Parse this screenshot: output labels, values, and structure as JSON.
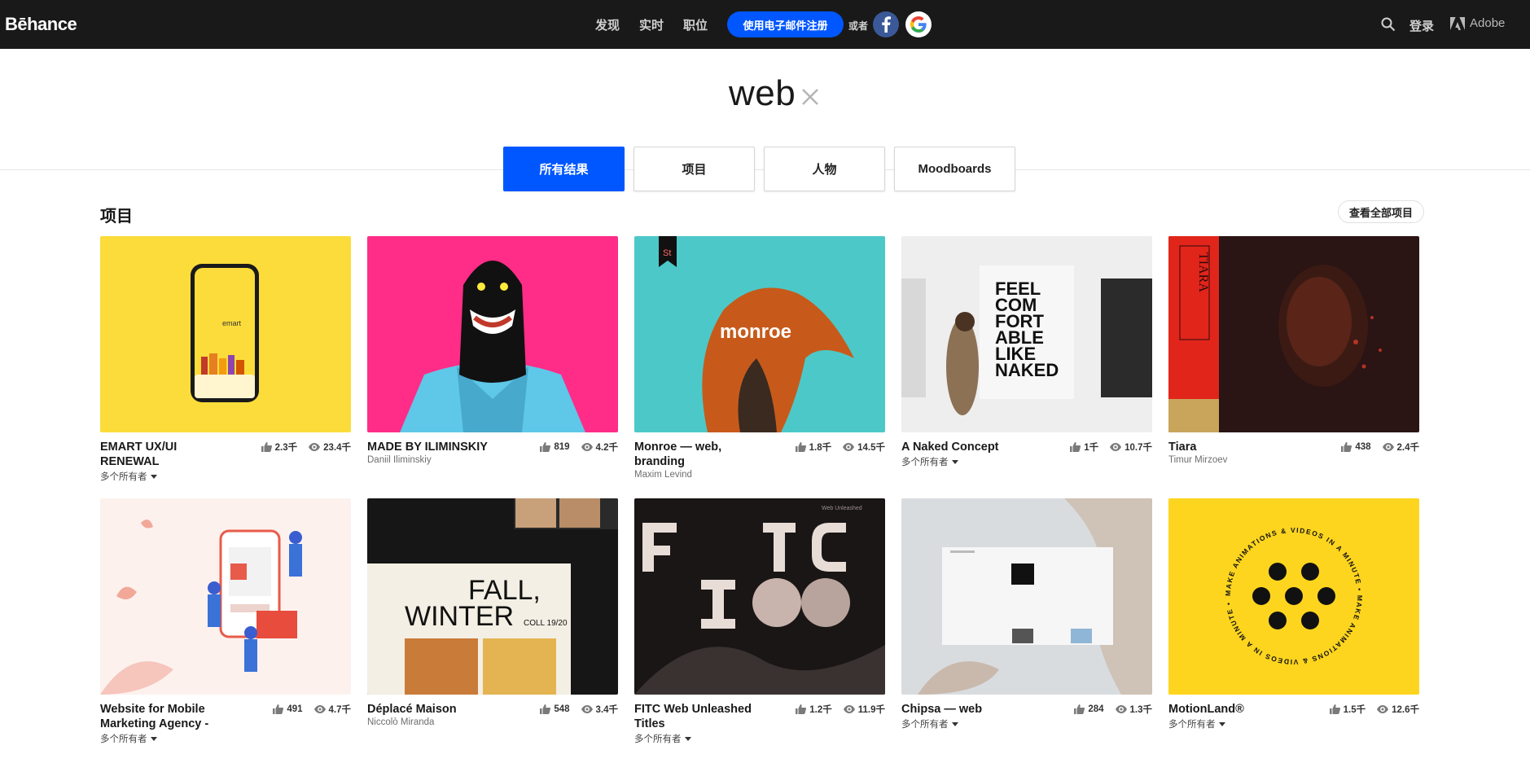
{
  "header": {
    "logo": "Bēhance",
    "nav": [
      "发现",
      "实时",
      "职位"
    ],
    "signup": "使用电子邮件注册",
    "or": "或者",
    "login": "登录",
    "adobe": "Adobe"
  },
  "search": {
    "query": "web"
  },
  "tabs": [
    "所有结果",
    "项目",
    "人物",
    "Moodboards"
  ],
  "section": {
    "title": "项目",
    "see_all": "查看全部项目"
  },
  "cards": [
    {
      "title": "EMART UX/UI RENEWAL",
      "owner": "多个所有者",
      "likes": "2.3千",
      "views": "23.4千"
    },
    {
      "title": "MADE BY ILIMINSKIY",
      "owner": "Daniil Iliminskiy",
      "likes": "819",
      "views": "4.2千"
    },
    {
      "title": "Monroe — web, branding",
      "owner": "Maxim Levind",
      "likes": "1.8千",
      "views": "14.5千"
    },
    {
      "title": "A Naked Concept",
      "owner": "多个所有者",
      "likes": "1千",
      "views": "10.7千"
    },
    {
      "title": "Tiara",
      "owner": "Timur Mirzoev",
      "likes": "438",
      "views": "2.4千"
    },
    {
      "title": "Website for Mobile Marketing Agency -",
      "owner": "多个所有者",
      "likes": "491",
      "views": "4.7千"
    },
    {
      "title": "Déplacé Maison",
      "owner": "Niccolò Miranda",
      "likes": "548",
      "views": "3.4千"
    },
    {
      "title": "FITC Web Unleashed Titles",
      "owner": "多个所有者",
      "likes": "1.2千",
      "views": "11.9千"
    },
    {
      "title": "Chipsa — web",
      "owner": "多个所有者",
      "likes": "284",
      "views": "1.3千"
    },
    {
      "title": "MotionLand®",
      "owner": "多个所有者",
      "likes": "1.5千",
      "views": "12.6千"
    }
  ],
  "artwork_text": {
    "emart_logo": "emart",
    "monroe": "monroe",
    "monroe_badge": "St",
    "naked_lines": [
      "FEEL",
      "COM",
      "FORT",
      "ABLE",
      "LIKE",
      "NAKED"
    ],
    "tiara": "TIARA",
    "fall": "FALL,",
    "winter": "WINTER",
    "coll": "COLL 19/20",
    "fitc_small": "Web Unleashed",
    "motion_ring": "MAKE ANIMATIONS & VIDEOS IN A MINUTE • MAKE ANIMATIONS & VIDEOS IN A MINUTE •"
  }
}
